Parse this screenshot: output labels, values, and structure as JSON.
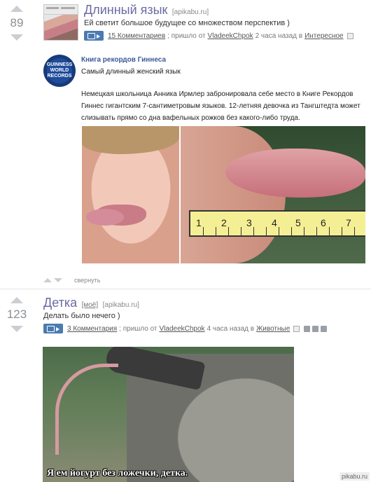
{
  "post1": {
    "score": "89",
    "title": "Длинный язык",
    "domain": "[apikabu.ru]",
    "description": "Ей светит большое будущее со множеством перспектив )",
    "comments": "15 Комментариев",
    "meta_sep1": "; пришло от",
    "author": "VladeekChpok",
    "meta_time": "2 часа назад в",
    "category": "Интересное",
    "source_name": "Книга рекордов Гиннеса",
    "source_subtitle": "Самый длинный женский язык",
    "logo_text": "GUINNESS WORLD RECORDS",
    "article_text": "Немецкая школьница Анника Ирмлер забронировала себе место в Книге Рекордов Гиннес гигантским 7-сантиметровым языков. 12-летняя девочка из Тангштедта может слизывать прямо со дна вафельных рожков без какого-либо труда.",
    "ruler_labels": [
      "1",
      "2",
      "3",
      "4",
      "5",
      "6",
      "7"
    ],
    "collapse_label": "свернуть"
  },
  "post2": {
    "score": "123",
    "title": "Детка",
    "tag": "[моё]",
    "domain": "[apikabu.ru]",
    "description": "Делать было нечего )",
    "comments": "3 Комментария",
    "meta_sep1": "; пришло от",
    "author": "VladeekChpok",
    "meta_time": "4 часа назад в",
    "category": "Животные",
    "caption": "Я ем йогурт без ложечки, детка."
  },
  "watermark": "pikabu.ru",
  "colors": {
    "title": "#6b6aa3",
    "camera": "#4a7bb0",
    "arrow": "#c9ced3"
  }
}
